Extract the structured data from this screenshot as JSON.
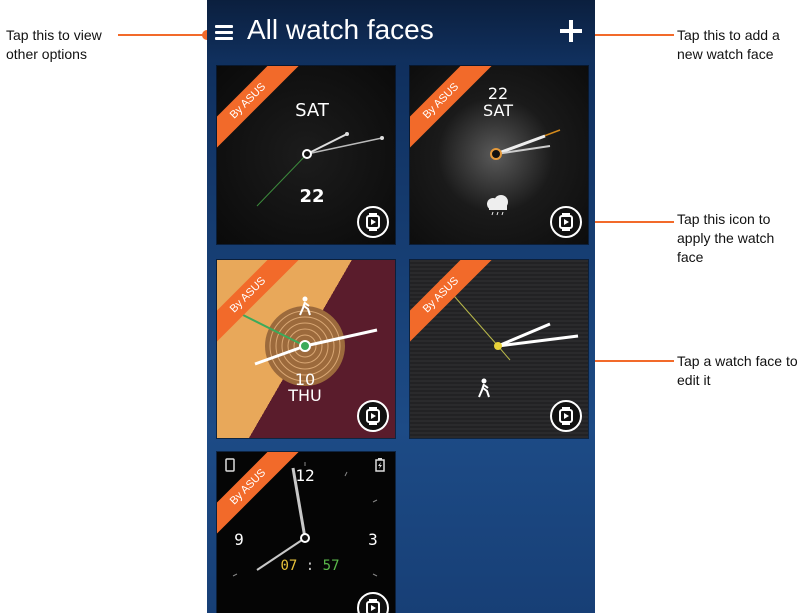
{
  "callouts": {
    "options": "Tap this to view other options",
    "add": "Tap this to add a new watch face",
    "apply": "Tap this icon to apply the watch face",
    "edit": "Tap a watch face to edit it"
  },
  "header": {
    "title": "All watch faces"
  },
  "colors": {
    "accent": "#f26a2a",
    "background_top": "#0d2b57",
    "background_bottom": "#1d4b86"
  },
  "watch_faces": [
    {
      "badge": "By ASUS",
      "day": "SAT",
      "date": "22"
    },
    {
      "badge": "By ASUS",
      "date": "22",
      "day": "SAT",
      "weather_icon": "cloud-rain-icon"
    },
    {
      "badge": "By ASUS",
      "date": "10",
      "day": "THU",
      "activity_icon": "walking-person-icon"
    },
    {
      "badge": "By ASUS",
      "activity_icon": "walking-person-icon"
    },
    {
      "badge": "By ASUS",
      "num_12": "12",
      "num_9": "9",
      "num_3": "3",
      "time_hour": "07",
      "time_sep": ":",
      "time_min": "57"
    }
  ]
}
